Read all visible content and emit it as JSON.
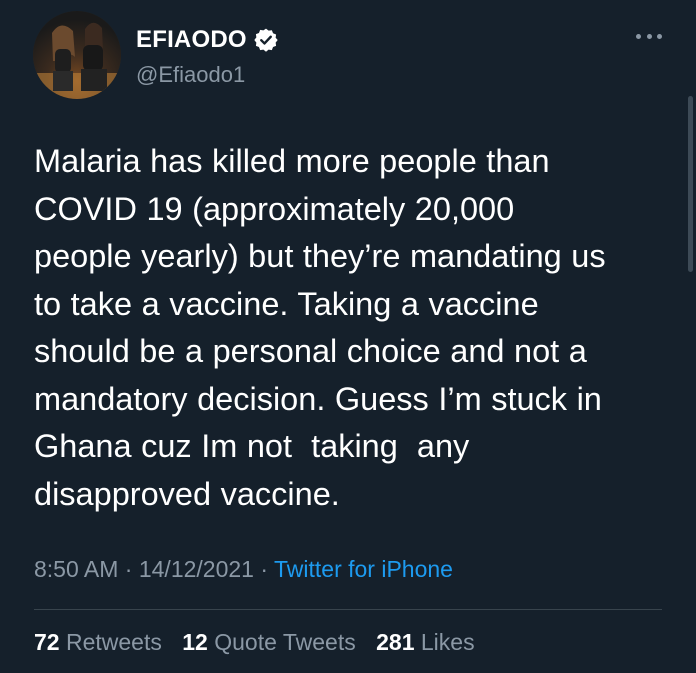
{
  "author": {
    "display_name": "EFIAODO",
    "handle": "@Efiaodo1",
    "verified": true
  },
  "tweet": {
    "text": "Malaria has killed more people than\nCOVID 19 (approximately 20,000\npeople yearly) but they’re mandating us\nto take a vaccine. Taking a vaccine\nshould be a personal choice and not a\nmandatory decision. Guess I’m stuck in\nGhana cuz Im not  taking  any\ndisapproved vaccine.",
    "time": "8:50 AM",
    "separator": " · ",
    "date": "14/12/2021",
    "source": "Twitter for iPhone"
  },
  "stats": {
    "retweets_count": "72",
    "retweets_label": "Retweets",
    "quote_count": "12",
    "quote_label": "Quote Tweets",
    "likes_count": "281",
    "likes_label": "Likes"
  },
  "icons": {
    "verified": "verified-badge-icon",
    "more": "more-options-icon"
  },
  "colors": {
    "background": "#15202b",
    "text_primary": "#ffffff",
    "text_secondary": "#8b98a5",
    "link": "#1d9bf0",
    "divider": "#38444d"
  }
}
